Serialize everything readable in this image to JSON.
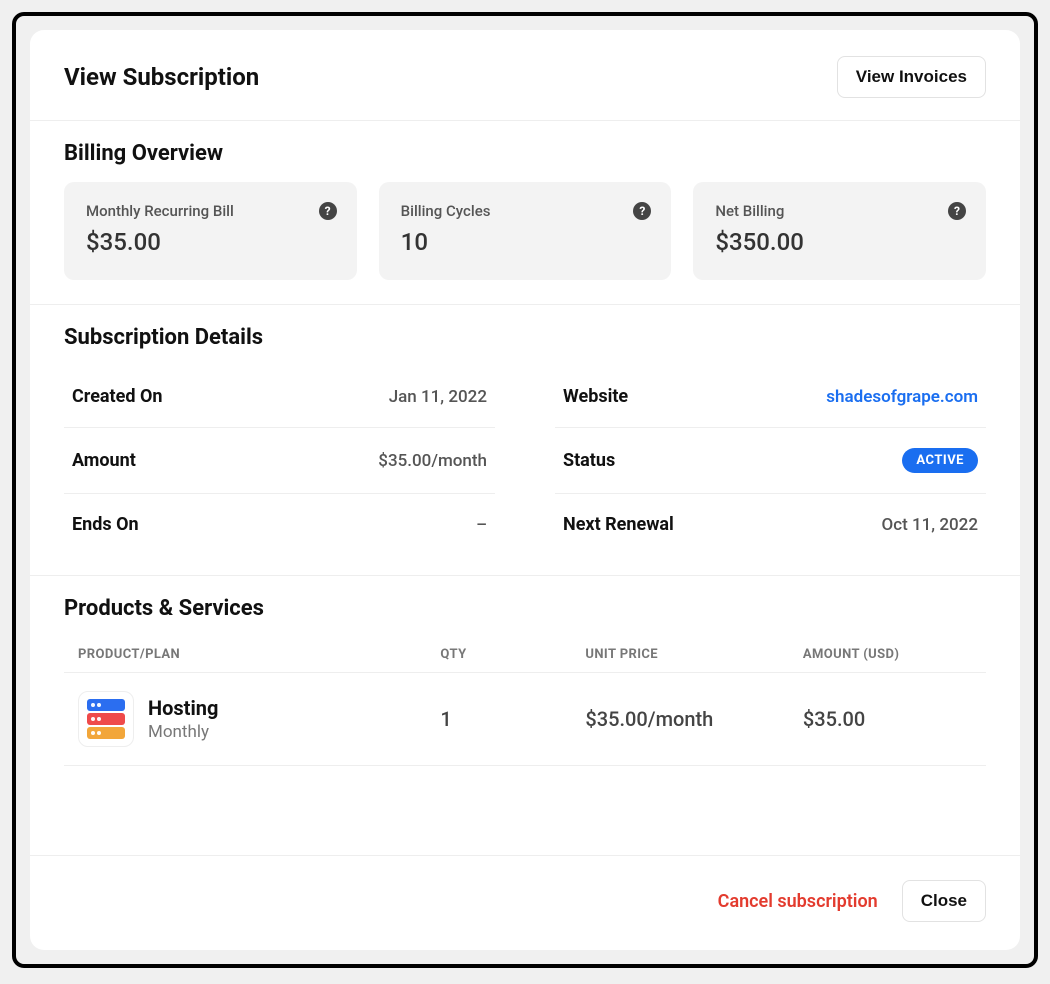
{
  "header": {
    "title": "View Subscription",
    "view_invoices": "View Invoices"
  },
  "billing_overview": {
    "title": "Billing Overview",
    "cards": [
      {
        "label": "Monthly Recurring Bill",
        "value": "$35.00"
      },
      {
        "label": "Billing Cycles",
        "value": "10"
      },
      {
        "label": "Net Billing",
        "value": "$350.00"
      }
    ]
  },
  "details": {
    "title": "Subscription Details",
    "created_on": {
      "label": "Created On",
      "value": "Jan 11, 2022"
    },
    "amount": {
      "label": "Amount",
      "value": "$35.00/month"
    },
    "ends_on": {
      "label": "Ends On",
      "value": "–"
    },
    "website": {
      "label": "Website",
      "value": "shadesofgrape.com"
    },
    "status": {
      "label": "Status",
      "value": "ACTIVE"
    },
    "next_renewal": {
      "label": "Next Renewal",
      "value": "Oct 11, 2022"
    }
  },
  "products": {
    "title": "Products & Services",
    "columns": {
      "plan": "PRODUCT/PLAN",
      "qty": "QTY",
      "unit_price": "UNIT PRICE",
      "amount": "AMOUNT (USD)"
    },
    "rows": [
      {
        "name": "Hosting",
        "sub": "Monthly",
        "qty": "1",
        "unit_price": "$35.00/month",
        "amount": "$35.00"
      }
    ]
  },
  "footer": {
    "cancel": "Cancel subscription",
    "close": "Close"
  }
}
